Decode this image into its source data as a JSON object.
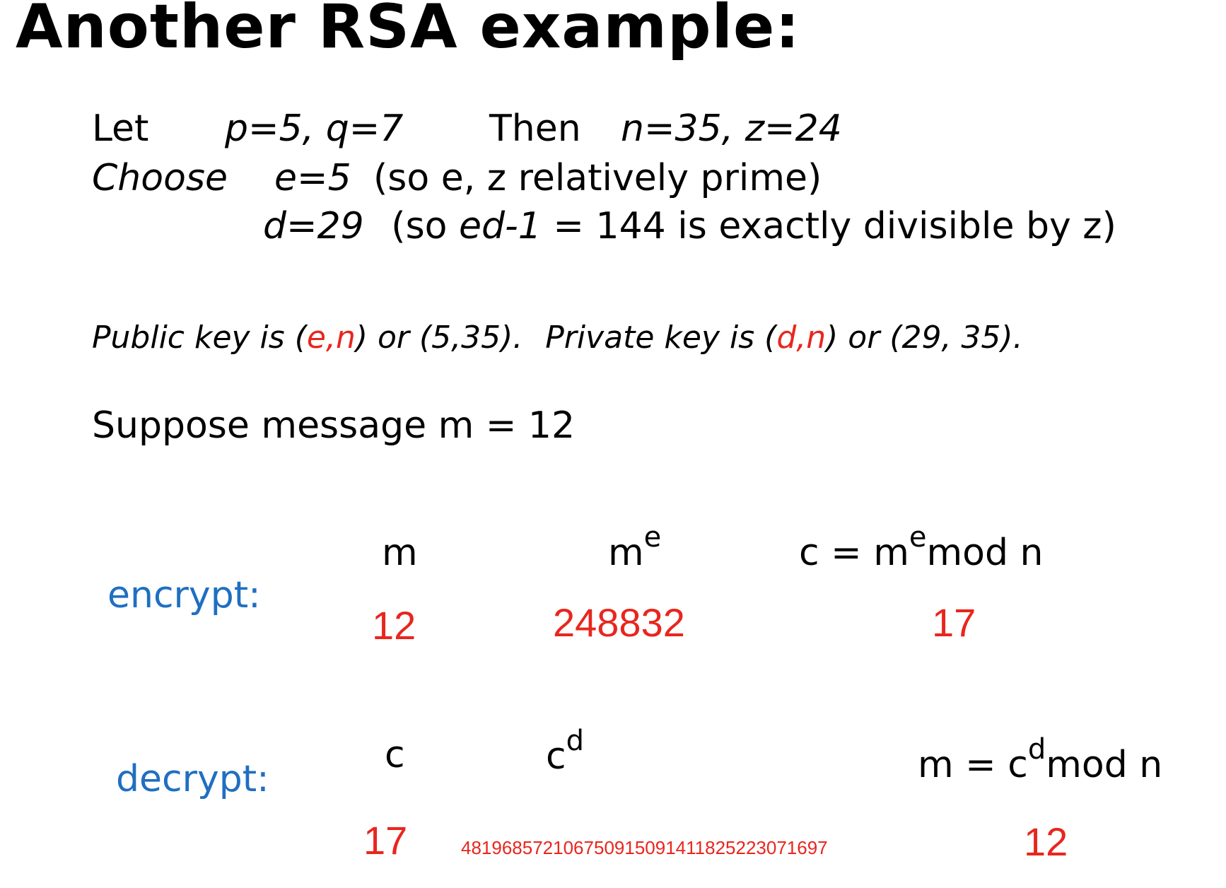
{
  "title": "Another RSA example:",
  "line1": {
    "let": "Let",
    "pq": "p=5, q=7",
    "then": "Then",
    "nz": "n=35, z=24"
  },
  "line2": {
    "choose": "Choose",
    "e": "e=5",
    "note": "(so e, z relatively prime)"
  },
  "line3": {
    "d": "d=29",
    "note_open": "(so",
    "ed": "ed-1",
    "note_rest": "= 144 is exactly divisible by z)"
  },
  "keys": {
    "public_prefix": "Public key is (",
    "public_e": "e",
    "comma1": ",",
    "public_n": "n",
    "public_suffix": ") or (5,35).",
    "private_prefix": "Private key is (",
    "private_d": "d",
    "comma2": ",",
    "private_n": "n",
    "private_suffix": ") or (29, 35)."
  },
  "message": "Suppose message m = 12",
  "encrypt": {
    "label": "encrypt:",
    "h1": "m",
    "h2_base": "m",
    "h2_sup": "e",
    "h3_pre": "c = m",
    "h3_sup": "e",
    "h3_post": "mod  n",
    "v1": "12",
    "v2": "248832",
    "v3": "17"
  },
  "decrypt": {
    "label": "decrypt:",
    "h1": "c",
    "h2_base": "c",
    "h2_sup": "d",
    "h3_pre": "m = c",
    "h3_sup": "d",
    "h3_post": "mod  n",
    "v1": "17",
    "v2": "481968572106750915091411825223071697",
    "v3": "12"
  },
  "colors": {
    "highlight": "#e8261e",
    "label": "#1f6fc1"
  }
}
